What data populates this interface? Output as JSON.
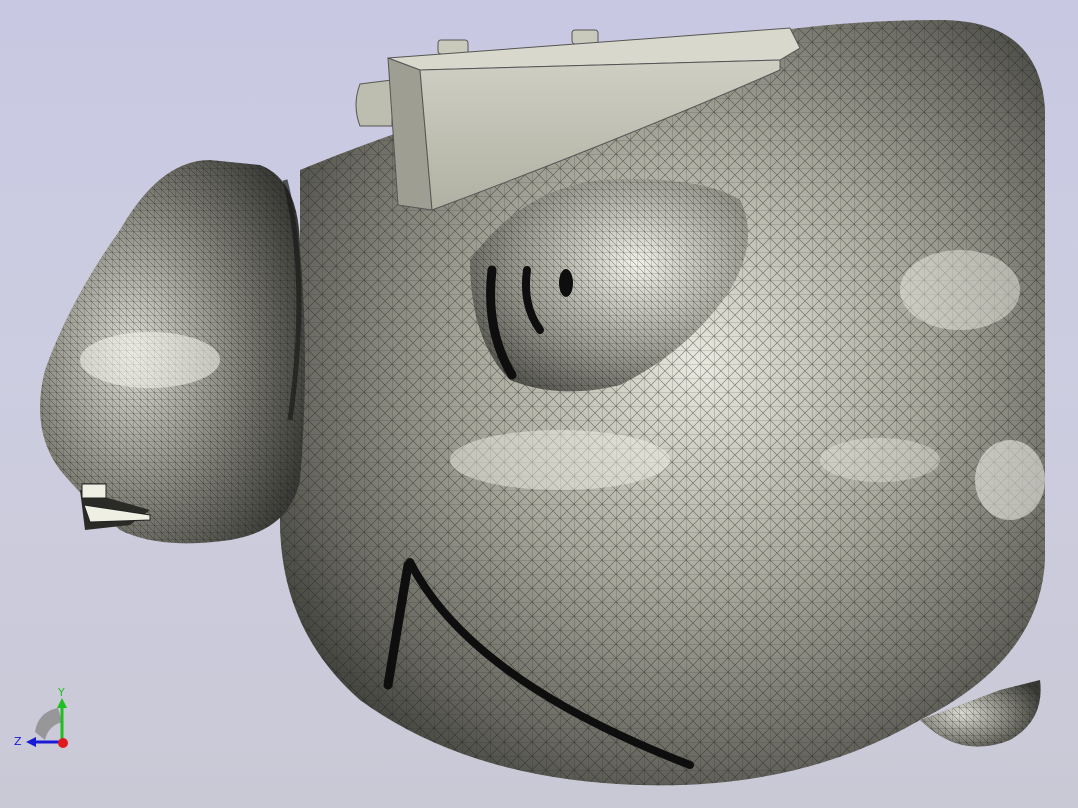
{
  "viewport": {
    "background_top": "#c8c8e2",
    "background_bottom": "#c9c9d6"
  },
  "model": {
    "surface_color": "#8a8a80",
    "highlight_color": "#f4f4ec",
    "mesh_color": "#1a1a1a",
    "fixture_color": "#c2c2b4"
  },
  "triad": {
    "y_label": "Y",
    "z_label": "Z",
    "y_color": "#1fbf1f",
    "z_color": "#1a1ad6",
    "x_color": "#e01a1a"
  }
}
